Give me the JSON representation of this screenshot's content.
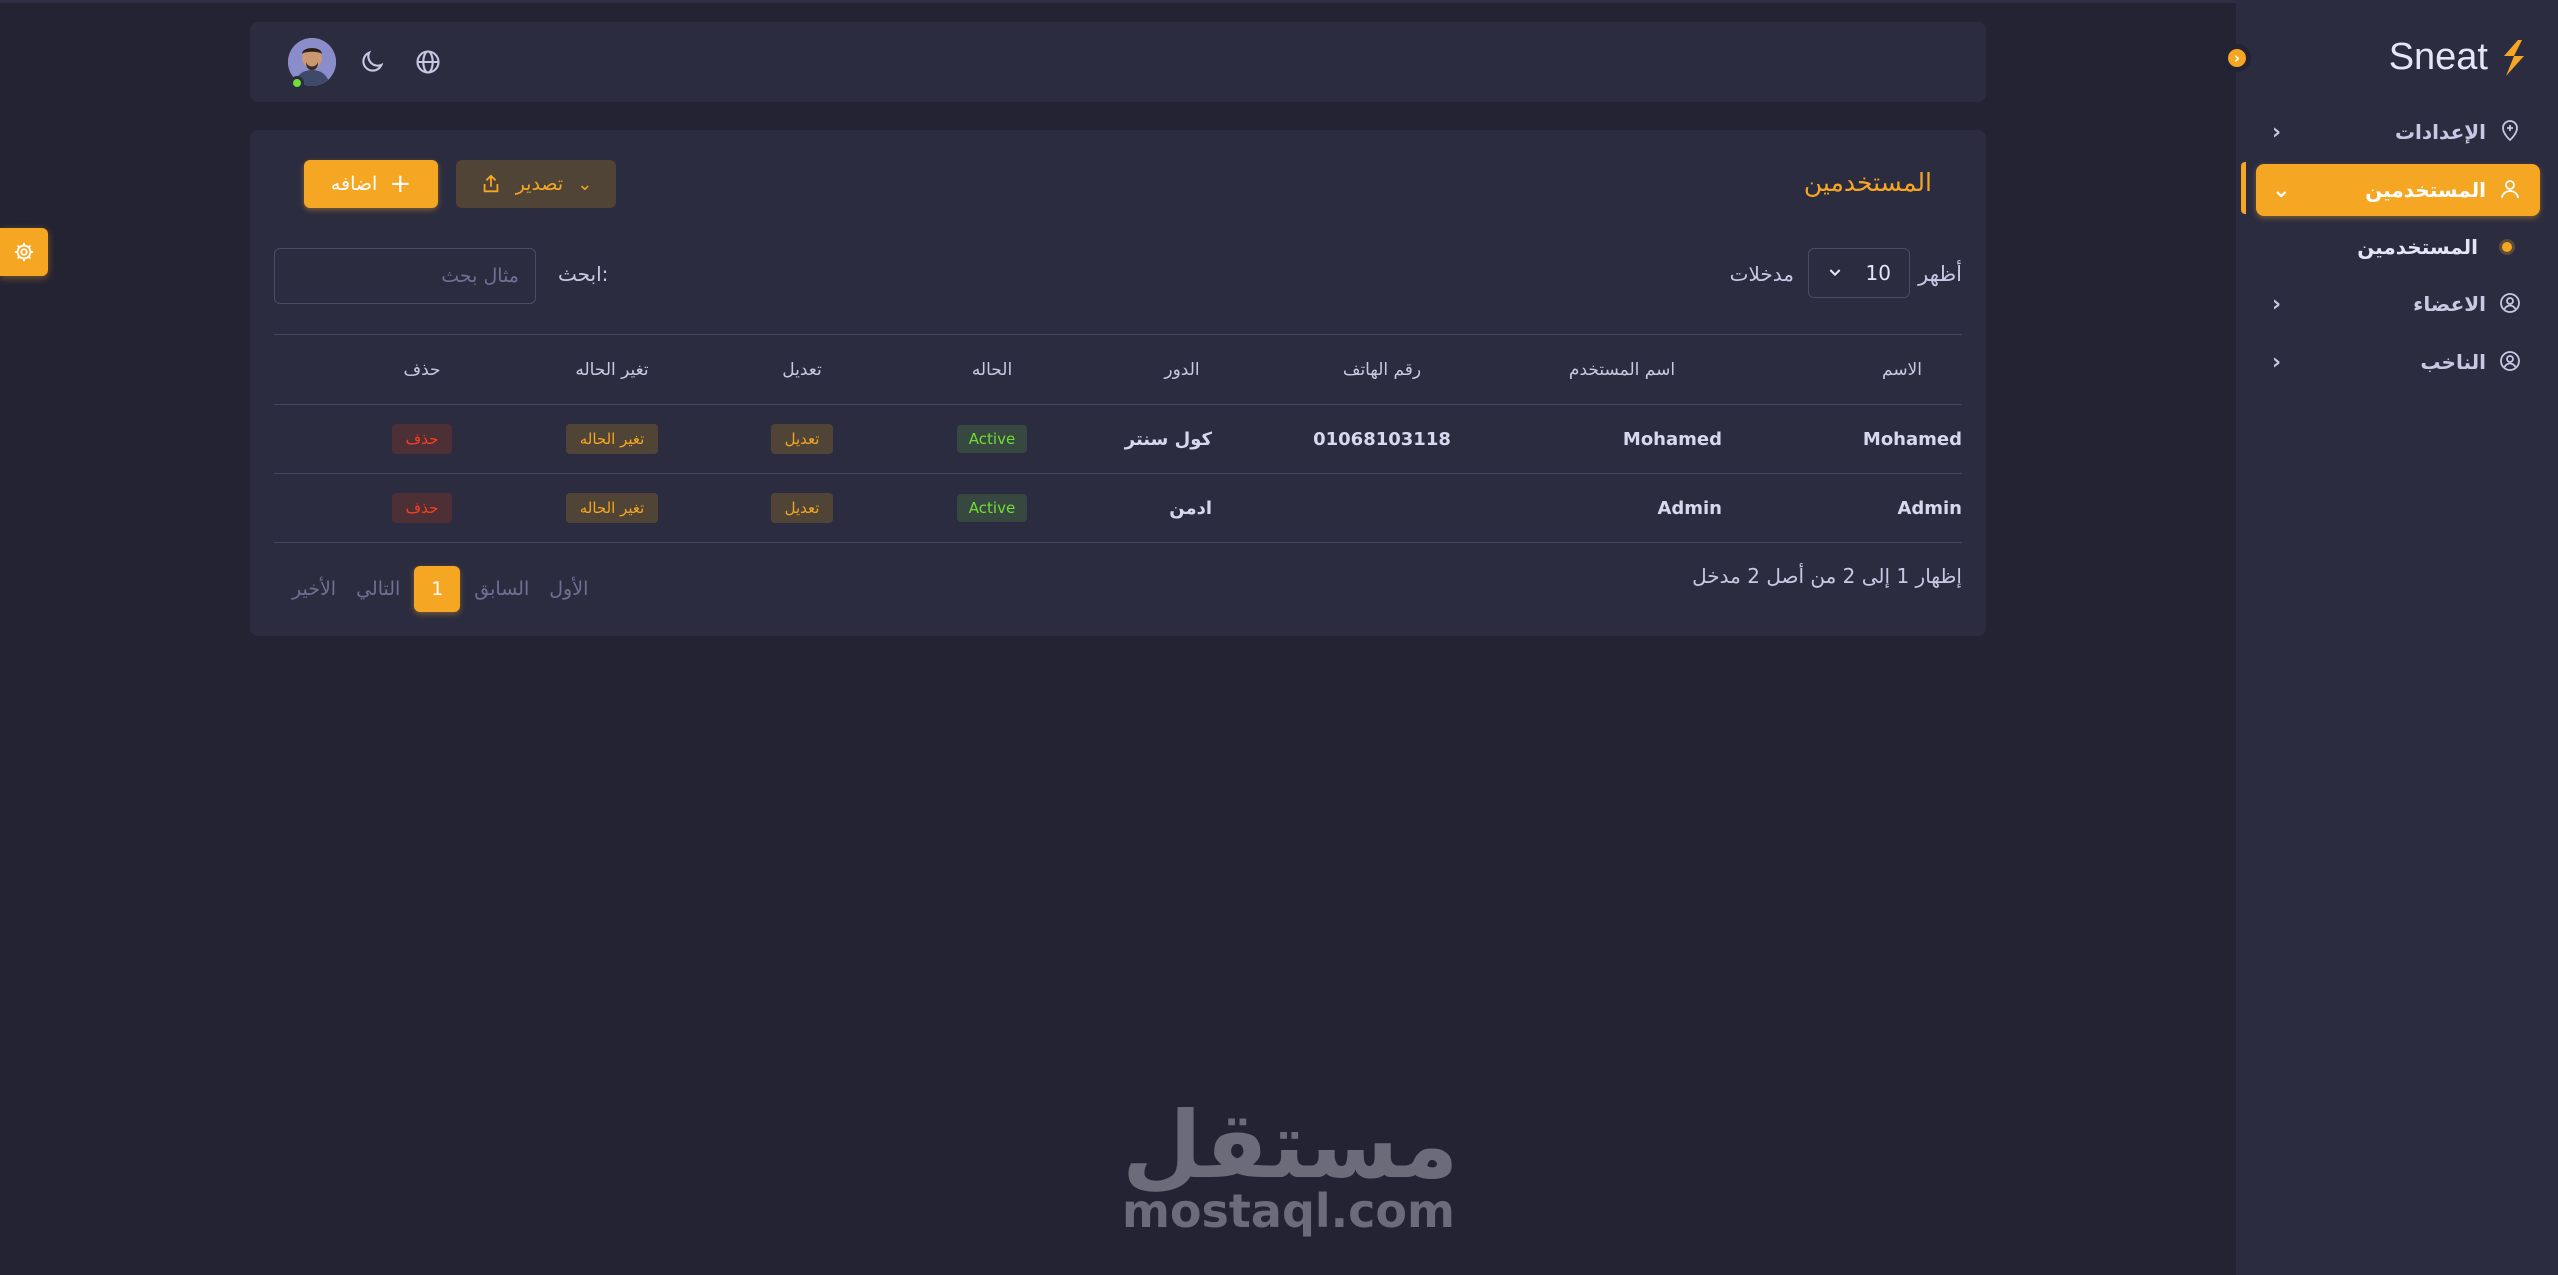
{
  "brand": {
    "name": "Sneat",
    "accent": "#f5a623"
  },
  "sidebar": {
    "items": [
      {
        "label": "الإعدادات",
        "icon": "location-pin-icon",
        "active": false
      },
      {
        "label": "المستخدمين",
        "icon": "user-icon",
        "active": true
      },
      {
        "label": "الاعضاء",
        "icon": "user-circle-icon",
        "active": false
      },
      {
        "label": "الناخب",
        "icon": "user-circle-icon",
        "active": false
      }
    ],
    "sub_items": [
      {
        "label": "المستخدمين",
        "active": true
      }
    ]
  },
  "navbar": {
    "icons": [
      "language-globe-icon",
      "dark-mode-moon-icon"
    ],
    "user_status": "online"
  },
  "card": {
    "title": "المستخدمين",
    "add_label": "اضافه",
    "export_label": "تصدير",
    "show_label": "أظهر",
    "entries_value": "10",
    "entries_label": "مدخلات",
    "search_label": "ابحث:",
    "search_placeholder": "مثال بحث"
  },
  "table": {
    "headers": [
      "الاسم",
      "اسم المستخدم",
      "رقم الهاتف",
      "الدور",
      "الحاله",
      "تعديل",
      "تغير الحاله",
      "حذف"
    ],
    "rows": [
      {
        "name": "Mohamed",
        "username": "Mohamed",
        "phone": "01068103118",
        "role": "كول سنتر",
        "status": "Active",
        "edit": "تعديل",
        "change_status": "تغير الحاله",
        "delete": "حذف"
      },
      {
        "name": "Admin",
        "username": "Admin",
        "phone": "",
        "role": "ادمن",
        "status": "Active",
        "edit": "تعديل",
        "change_status": "تغير الحاله",
        "delete": "حذف"
      }
    ]
  },
  "footer": {
    "info": "إظهار 1 إلى 2 من أصل 2 مدخل",
    "pagination": {
      "first": "الأول",
      "previous": "السابق",
      "current": "1",
      "next": "التالي",
      "last": "الأخير"
    }
  },
  "watermark": {
    "arabic": "مستقل",
    "latin": "mostaql.com"
  }
}
